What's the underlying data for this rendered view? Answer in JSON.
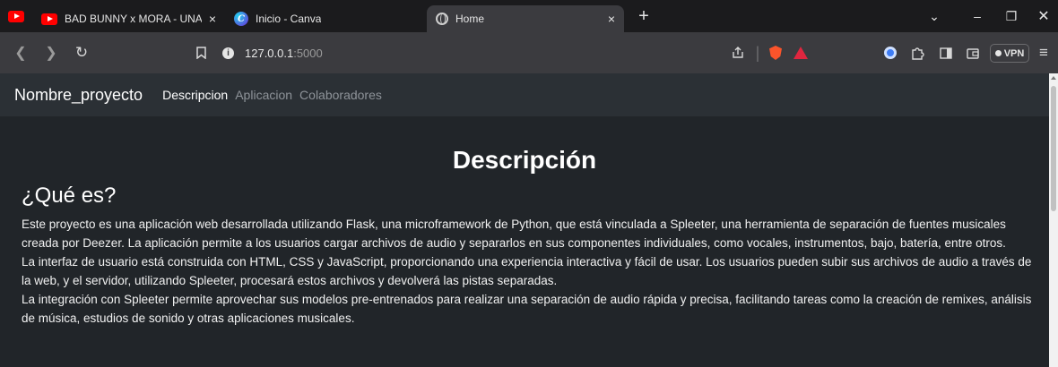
{
  "browser": {
    "tabs": [
      {
        "title": "BAD BUNNY x MORA - UNA VEZ",
        "close": "×"
      },
      {
        "title": "Inicio - Canva",
        "close": ""
      },
      {
        "title": "Home",
        "close": "×"
      }
    ],
    "new_tab": "+",
    "address": {
      "host": "127.0.0.1",
      "port": ":5000"
    },
    "vpn_label": "VPN",
    "accent": "#fb542b"
  },
  "navbar": {
    "brand": "Nombre_proyecto",
    "links": [
      "Descripcion",
      "Aplicacion",
      "Colaboradores"
    ],
    "active": "Descripcion"
  },
  "content": {
    "title": "Descripción",
    "subtitle": "¿Qué es?",
    "paragraphs": [
      "Este proyecto es una aplicación web desarrollada utilizando Flask, una microframework de Python, que está vinculada a Spleeter, una herramienta de separación de fuentes musicales creada por Deezer. La aplicación permite a los usuarios cargar archivos de audio y separarlos en sus componentes individuales, como vocales, instrumentos, bajo, batería, entre otros.",
      "La interfaz de usuario está construida con HTML, CSS y JavaScript, proporcionando una experiencia interactiva y fácil de usar. Los usuarios pueden subir sus archivos de audio a través de la web, y el servidor, utilizando Spleeter, procesará estos archivos y devolverá las pistas separadas.",
      "La integración con Spleeter permite aprovechar sus modelos pre-entrenados para realizar una separación de audio rápida y precisa, facilitando tareas como la creación de remixes, análisis de música, estudios de sonido y otras aplicaciones musicales."
    ]
  }
}
